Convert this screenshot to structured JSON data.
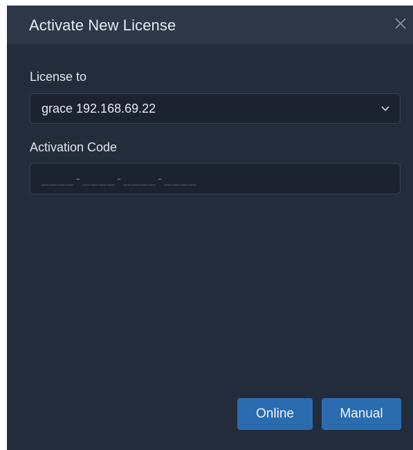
{
  "dialog": {
    "title": "Activate New License"
  },
  "license_to": {
    "label": "License to",
    "selected": "grace 192.168.69.22"
  },
  "activation_code": {
    "label": "Activation Code",
    "value": "",
    "placeholder": "____-____-____-____"
  },
  "buttons": {
    "online_label": "Online",
    "manual_label": "Manual"
  },
  "icons": {
    "close": "close-icon",
    "dropdown": "chevron-down-icon"
  },
  "colors": {
    "dialog_bg": "#232c3b",
    "title_bar_bg": "#2d3748",
    "input_bg": "#1b2230",
    "button_bg": "#2b6cb0"
  }
}
